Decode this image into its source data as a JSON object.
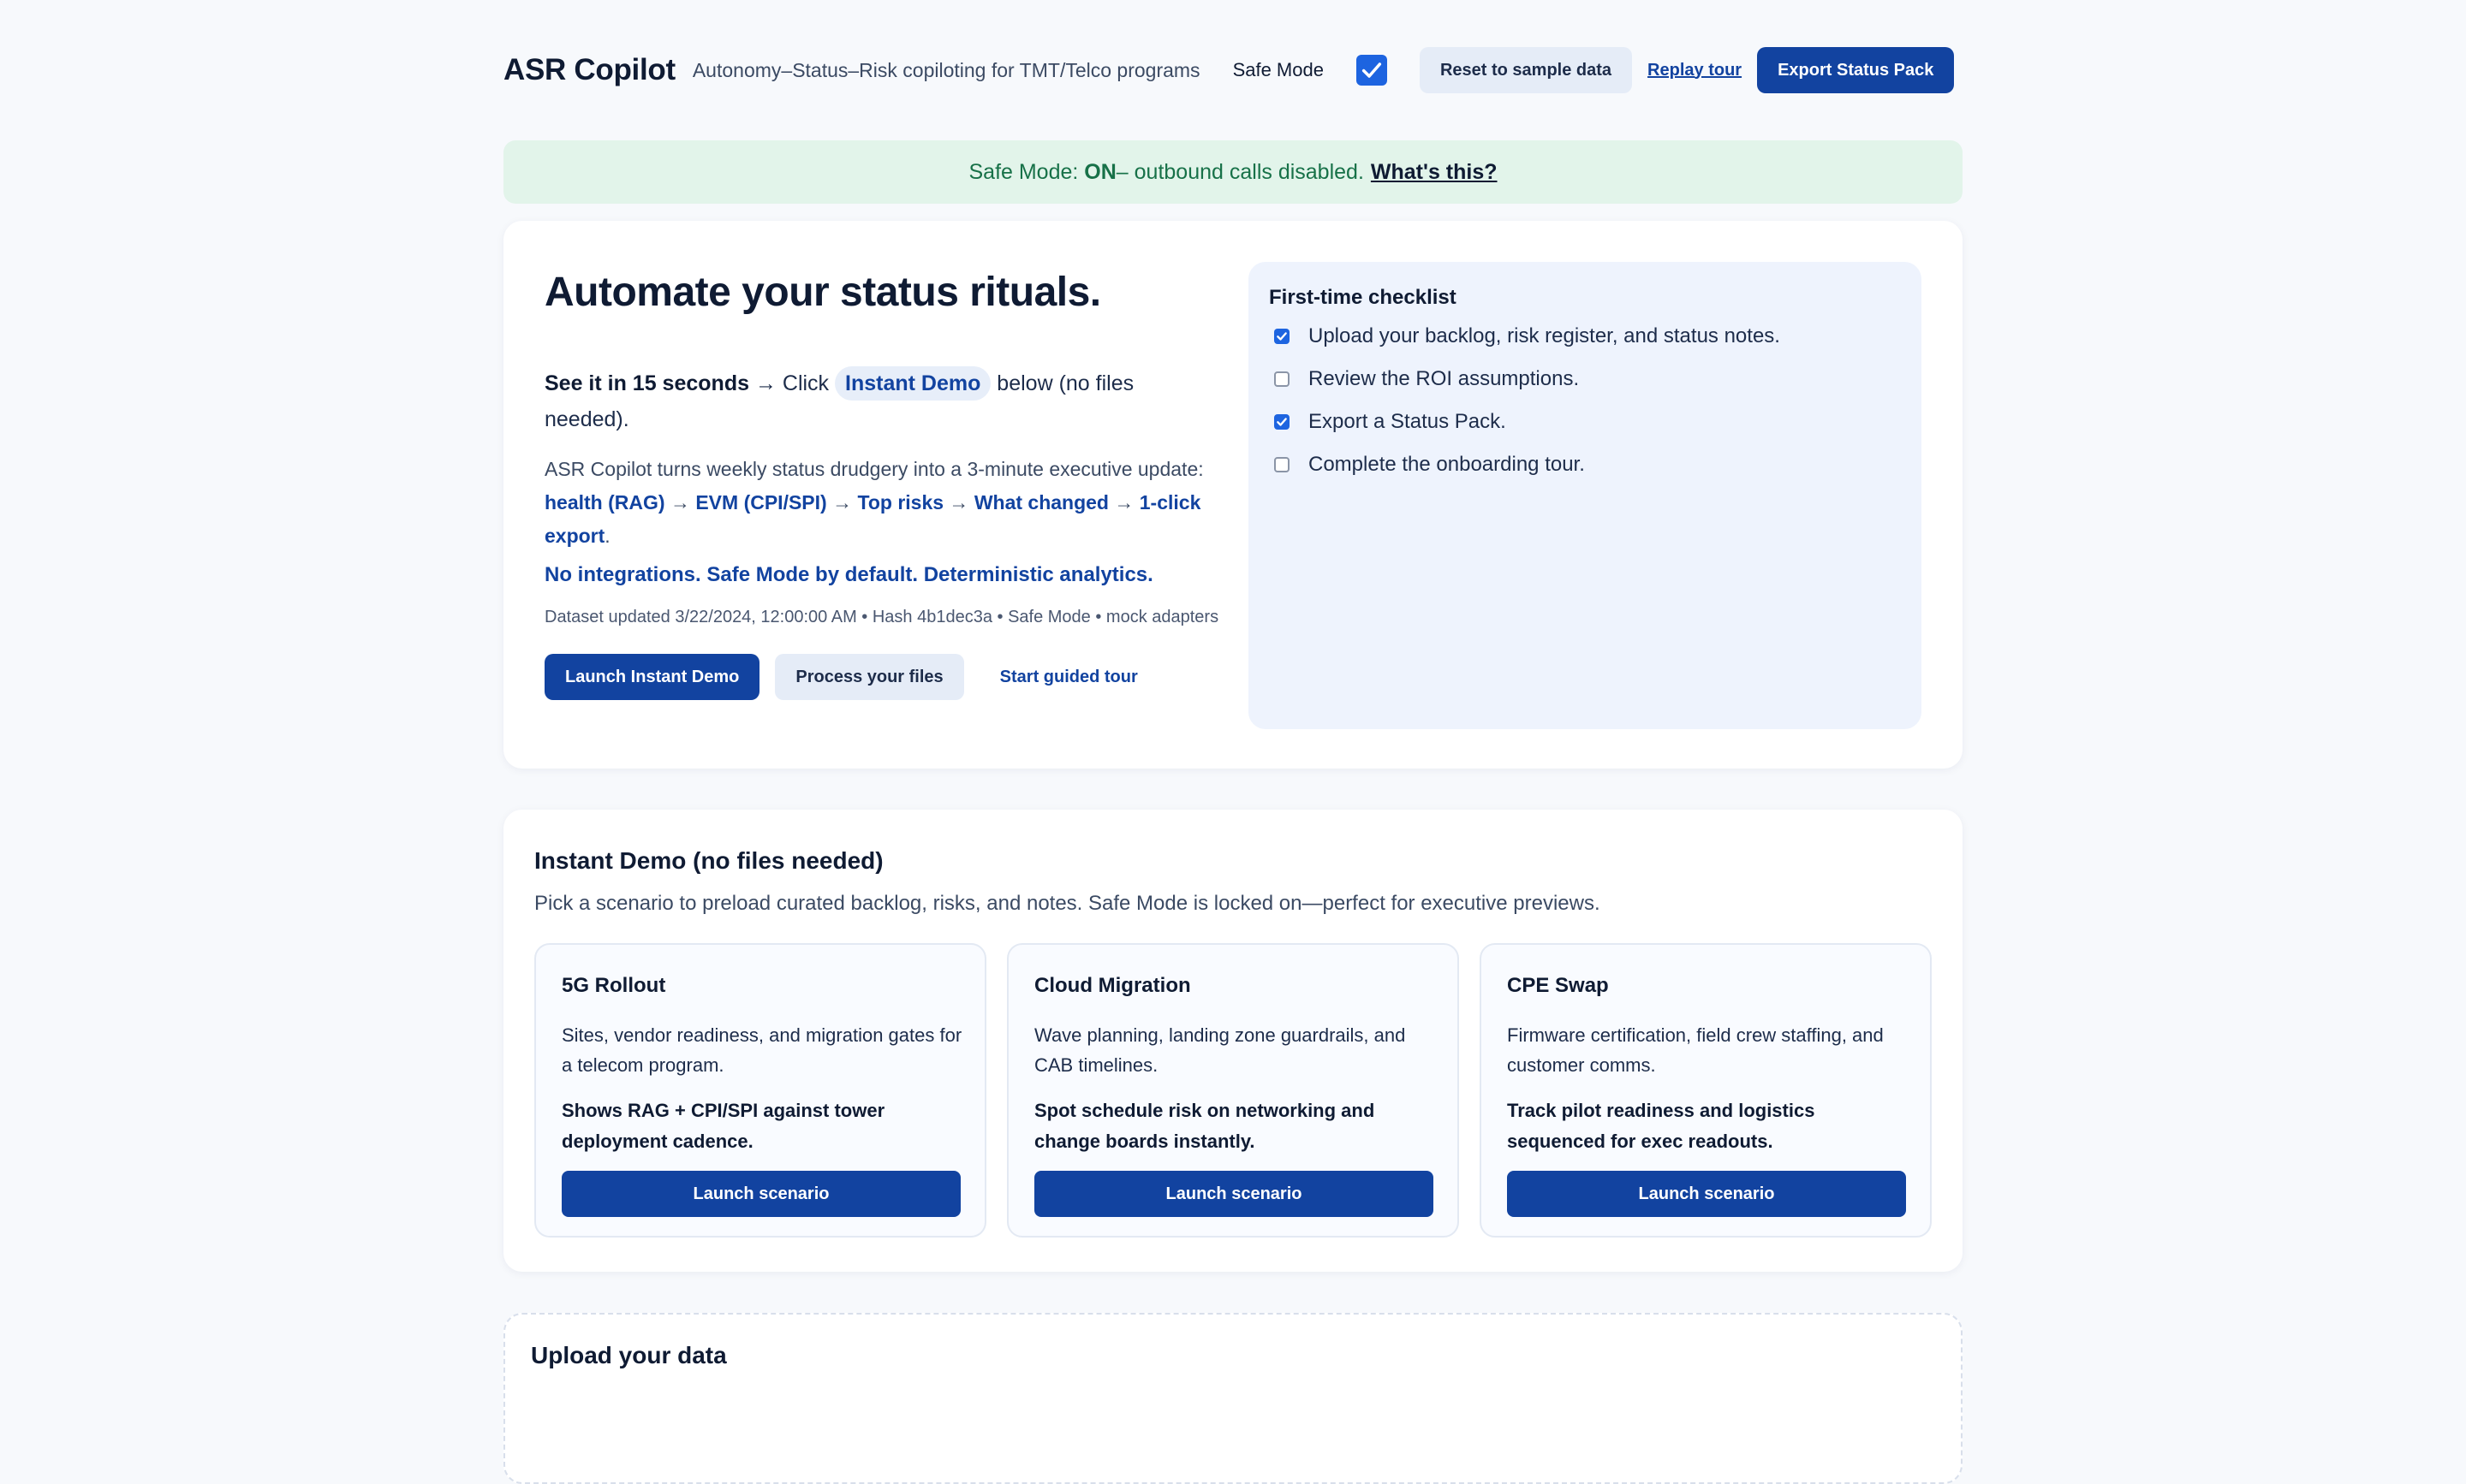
{
  "header": {
    "title": "ASR Copilot",
    "tagline": "Autonomy–Status–Risk copiloting for TMT/Telco programs",
    "safe_mode_label": "Safe Mode",
    "safe_mode_checked": true,
    "reset_label": "Reset to sample data",
    "replay_label": "Replay tour",
    "export_label": "Export Status Pack"
  },
  "banner": {
    "prefix": "Safe Mode: ",
    "state": "ON",
    "suffix": " – outbound calls disabled.",
    "link": "What's this?"
  },
  "hero": {
    "title": "Automate your status rituals.",
    "see_bold": "See it in 15 seconds",
    "see_click": " → Click ",
    "see_chip": "Instant Demo",
    "see_rest": " below (no files needed).",
    "desc_lead": "ASR Copilot turns weekly status drudgery into a 3-minute executive update: ",
    "pipeline": [
      {
        "text": "health (RAG)",
        "sep": " → "
      },
      {
        "text": "EVM (CPI/SPI)",
        "sep": " → "
      },
      {
        "text": "Top risks",
        "sep": " → "
      },
      {
        "text": "What changed",
        "sep": " → "
      },
      {
        "text": "1-click export",
        "sep": "."
      }
    ],
    "integrations_bold": "No integrations.",
    "integrations_rest": " Safe Mode by default. Deterministic analytics.",
    "meta": "Dataset updated 3/22/2024, 12:00:00 AM • Hash 4b1dec3a • Safe Mode • mock adapters",
    "actions": {
      "launch": "Launch Instant Demo",
      "process": "Process your files",
      "tour": "Start guided tour"
    }
  },
  "checklist": {
    "title": "First-time checklist",
    "items": [
      {
        "label": "Upload your backlog, risk register, and status notes.",
        "checked": true
      },
      {
        "label": "Review the ROI assumptions.",
        "checked": false
      },
      {
        "label": "Export a Status Pack.",
        "checked": true
      },
      {
        "label": "Complete the onboarding tour.",
        "checked": false
      }
    ]
  },
  "demo": {
    "title": "Instant Demo (no files needed)",
    "subtitle": "Pick a scenario to preload curated backlog, risks, and notes. Safe Mode is locked on—perfect for executive previews.",
    "scenarios": [
      {
        "name": "5G Rollout",
        "desc": "Sites, vendor readiness, and migration gates for a telecom program.",
        "highlight": "Shows RAG + CPI/SPI against tower deployment cadence.",
        "button": "Launch scenario"
      },
      {
        "name": "Cloud Migration",
        "desc": "Wave planning, landing zone guardrails, and CAB timelines.",
        "highlight": "Spot schedule risk on networking and change boards instantly.",
        "button": "Launch scenario"
      },
      {
        "name": "CPE Swap",
        "desc": "Firmware certification, field crew staffing, and customer comms.",
        "highlight": "Track pilot readiness and logistics sequenced for exec readouts.",
        "button": "Launch scenario"
      }
    ]
  },
  "upload": {
    "title": "Upload your data"
  },
  "icons": {
    "checkmark": "check-icon"
  },
  "colors": {
    "primary": "#1243a0",
    "accent": "#1d64e0",
    "banner_bg": "#e2f4ea",
    "banner_text": "#177148"
  }
}
